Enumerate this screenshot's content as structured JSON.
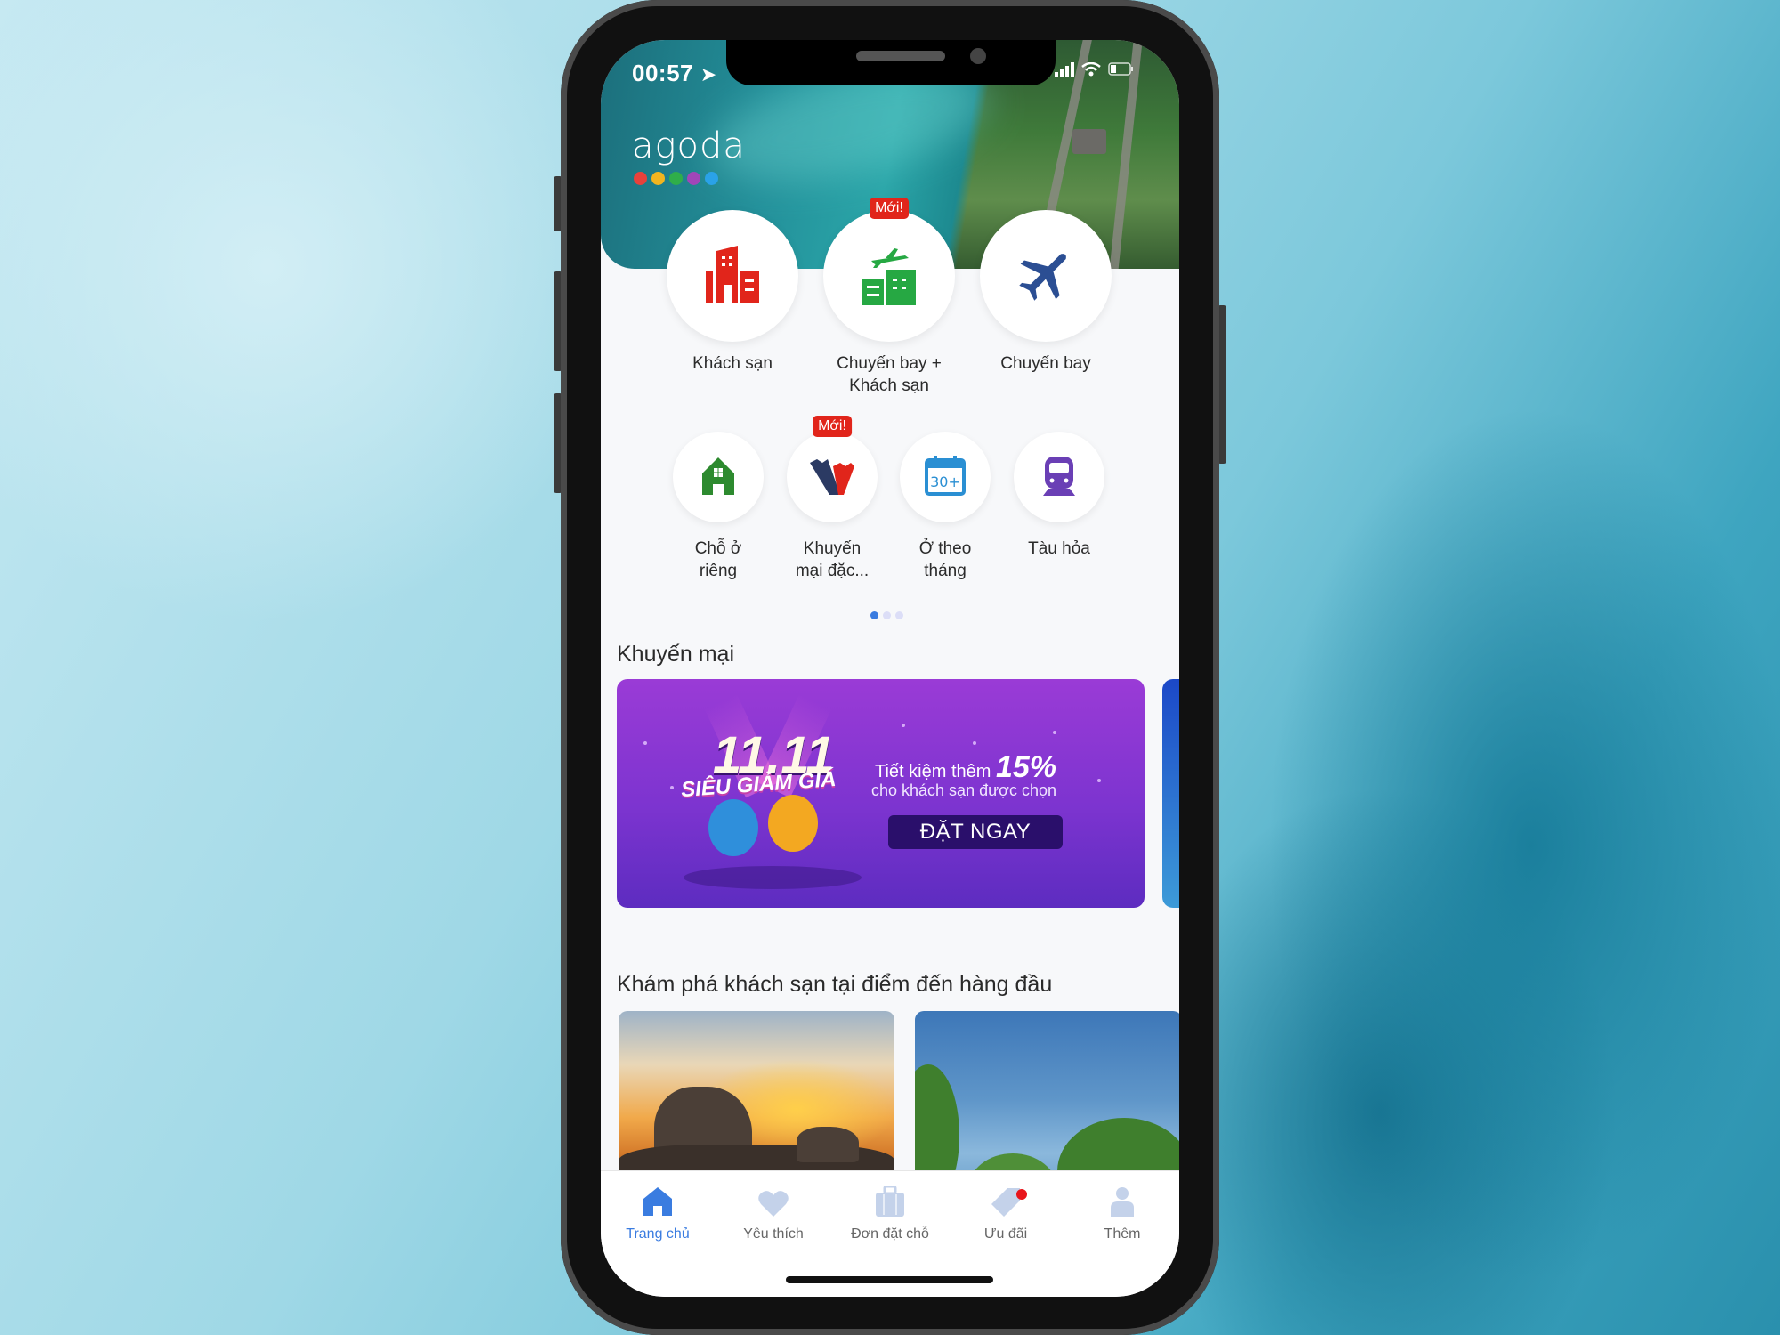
{
  "status_bar": {
    "time": "00:57",
    "location_icon": "location-arrow-icon",
    "signal_icon": "signal-icon",
    "wifi_icon": "wifi-icon",
    "battery_icon": "battery-icon"
  },
  "brand": {
    "name": "agoda",
    "dot_colors": [
      "#e8413b",
      "#f2b51f",
      "#2fae4a",
      "#a046b8",
      "#2aa2e8"
    ]
  },
  "primary_services": [
    {
      "label_line1": "Khách sạn",
      "label_line2": "",
      "icon": "hotel-icon",
      "color": "#e1251b",
      "badge": ""
    },
    {
      "label_line1": "Chuyến bay +",
      "label_line2": "Khách sạn",
      "icon": "flight-hotel-icon",
      "color": "#26a843",
      "badge": "Mới!"
    },
    {
      "label_line1": "Chuyến bay",
      "label_line2": "",
      "icon": "airplane-icon",
      "color": "#2b4e93",
      "badge": ""
    }
  ],
  "secondary_services": [
    {
      "label_line1": "Chỗ ở",
      "label_line2": "riêng",
      "icon": "private-home-icon",
      "color": "#2d8a2f",
      "badge": ""
    },
    {
      "label_line1": "Khuyến",
      "label_line2": "mại đặc...",
      "icon": "special-deals-icon",
      "color": "#2b3a63",
      "badge": "Mới!"
    },
    {
      "label_line1": "Ở theo",
      "label_line2": "tháng",
      "icon": "monthly-stay-calendar-icon",
      "color": "#2a8fd3",
      "badge": ""
    },
    {
      "label_line1": "Tàu hỏa",
      "label_line2": "",
      "icon": "train-icon",
      "color": "#6a3fb5",
      "badge": ""
    }
  ],
  "pager": {
    "pages": 3,
    "active": 1
  },
  "promotions": {
    "title": "Khuyến mại",
    "banner": {
      "event": "11.11",
      "subtitle": "SIÊU GIẢM GIÁ",
      "line1": "Tiết kiệm thêm",
      "discount": "15%",
      "line2": "cho khách sạn được chọn",
      "cta": "ĐẶT NGAY"
    }
  },
  "destinations": {
    "title": "Khám phá khách sạn tại điểm đến hàng đầu"
  },
  "tabbar": {
    "active_color": "#3a7ce0",
    "inactive_color": "#c4d2ea",
    "tabs": [
      {
        "label": "Trang chủ",
        "icon": "home-icon",
        "active": true,
        "notification": false
      },
      {
        "label": "Yêu thích",
        "icon": "heart-icon",
        "active": false,
        "notification": false
      },
      {
        "label": "Đơn đặt chỗ",
        "icon": "suitcase-icon",
        "active": false,
        "notification": false
      },
      {
        "label": "Ưu đãi",
        "icon": "tag-icon",
        "active": false,
        "notification": true
      },
      {
        "label": "Thêm",
        "icon": "person-icon",
        "active": false,
        "notification": false
      }
    ]
  }
}
